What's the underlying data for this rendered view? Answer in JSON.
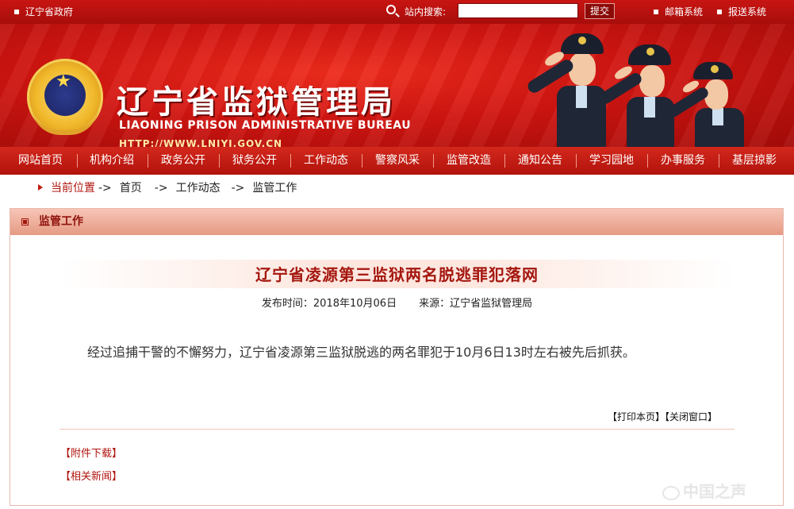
{
  "topbar": {
    "gov_link": "辽宁省政府",
    "search_label": "站内搜索:",
    "search_value": "",
    "submit_label": "提交",
    "mail_link": "邮箱系统",
    "report_link": "报送系统"
  },
  "banner": {
    "title_cn": "辽宁省监狱管理局",
    "title_en": "LIAONING PRISON ADMINISTRATIVE BUREAU",
    "url": "HTTP://WWW.LNJYJ.GOV.CN"
  },
  "nav": {
    "items": [
      "网站首页",
      "机构介绍",
      "政务公开",
      "狱务公开",
      "工作动态",
      "警察风采",
      "监管改造",
      "通知公告",
      "学习园地",
      "办事服务",
      "基层掠影"
    ]
  },
  "breadcrumb": {
    "here": "当前位置",
    "arrow": "->",
    "home": "首页",
    "level1": "工作动态",
    "level2": "监管工作"
  },
  "panel": {
    "heading": "监管工作"
  },
  "article": {
    "title": "辽宁省凌源第三监狱两名脱逃罪犯落网",
    "date": "发布时间：2018年10月06日",
    "source": "来源：辽宁省监狱管理局",
    "body": "经过追捕干警的不懈努力，辽宁省凌源第三监狱脱逃的两名罪犯于10月6日13时左右被先后抓获。"
  },
  "tools": {
    "print": "【打印本页】",
    "close": "【关闭窗口】"
  },
  "links": {
    "attachments": "【附件下载】",
    "related": "【相关新闻】"
  },
  "watermark": "中国之声",
  "colors": {
    "brand_red": "#c81512",
    "title_red": "#a4170f",
    "panel_head": "#e59a83"
  }
}
